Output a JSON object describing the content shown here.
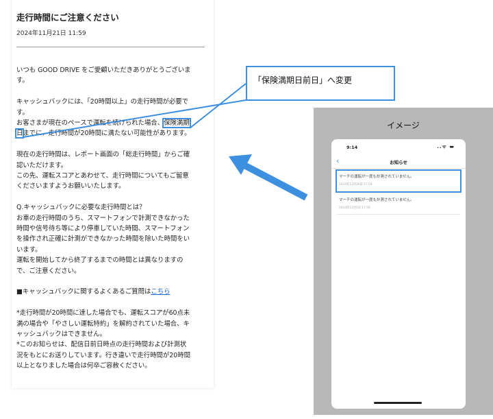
{
  "document": {
    "title": "走行時間にご注意ください",
    "date": "2024年11月21日 11:59",
    "para1": [
      "いつも GOOD DRIVE をご愛顧いただきありがとうございま",
      "す。"
    ],
    "para2_l1": "キャッシュバックには、「20時間以上」の走行時間が必要で",
    "para2_l2": "す。",
    "para2_l3_pre": "お客さまが現在のペースで運転を続けられた場合、",
    "para2_l3_highlight": "保険満期",
    "para2_l4_highlight": "日",
    "para2_l4_post": "までに、走行時間が20時間に満たない可能性があります。",
    "para3": [
      "現在の走行時間は、レポート画面の「総走行時間」からご確",
      "認いただけます。",
      "この先、運転スコアとあわせて、走行時間についてもご留意",
      "くださいますようお願いいたします。"
    ],
    "para4": [
      "Q.キャッシュバックに必要な走行時間とは？",
      "お車の走行時間のうち、スマートフォンで計測できなかった",
      "時間や信号待ち等により停車していた時間、スマートフォン",
      "を操作され正確に計測ができなかった時間を除いた時間をい",
      "います。",
      "運転を開始してから終了するまでの時間とは異なりますの",
      "で、ご注意ください。"
    ],
    "faq_text": "■キャッシュバックに関するよくあるご質問は",
    "faq_link": "こちら",
    "para6": [
      "*走行時間が20時間に達した場合でも、運転スコアが60点未",
      "満の場合や「やさしい運転特約」を解約されていた場合、キ",
      "ャッシュバックはできません。",
      "*このお知らせは、配信日前日時点の走行時間および計測状",
      "況をもとにお送りしています。行き違いで走行時間が20時間",
      "以上となりました場合は何卒ご容赦ください。"
    ]
  },
  "callout": {
    "text": "「保険満期日前日」へ変更"
  },
  "image_panel": {
    "label": "イメージ",
    "phone": {
      "time": "9:14",
      "status_icons": "..ᯤ ▬",
      "nav_title": "お知らせ",
      "back_icon": "chevron-left-icon",
      "notices": [
        {
          "title": "マーチの運転が一度も計測されていません。",
          "date": "2024年12月26日 17:59",
          "highlighted": true
        },
        {
          "title": "マーチの運転が一度も計測されていません。",
          "date": "2024年12月5日 17:59",
          "highlighted": false
        }
      ]
    }
  },
  "colors": {
    "accent": "#3d8fe0",
    "panel_gray": "#b8b8b8",
    "link": "#1a66d6"
  }
}
